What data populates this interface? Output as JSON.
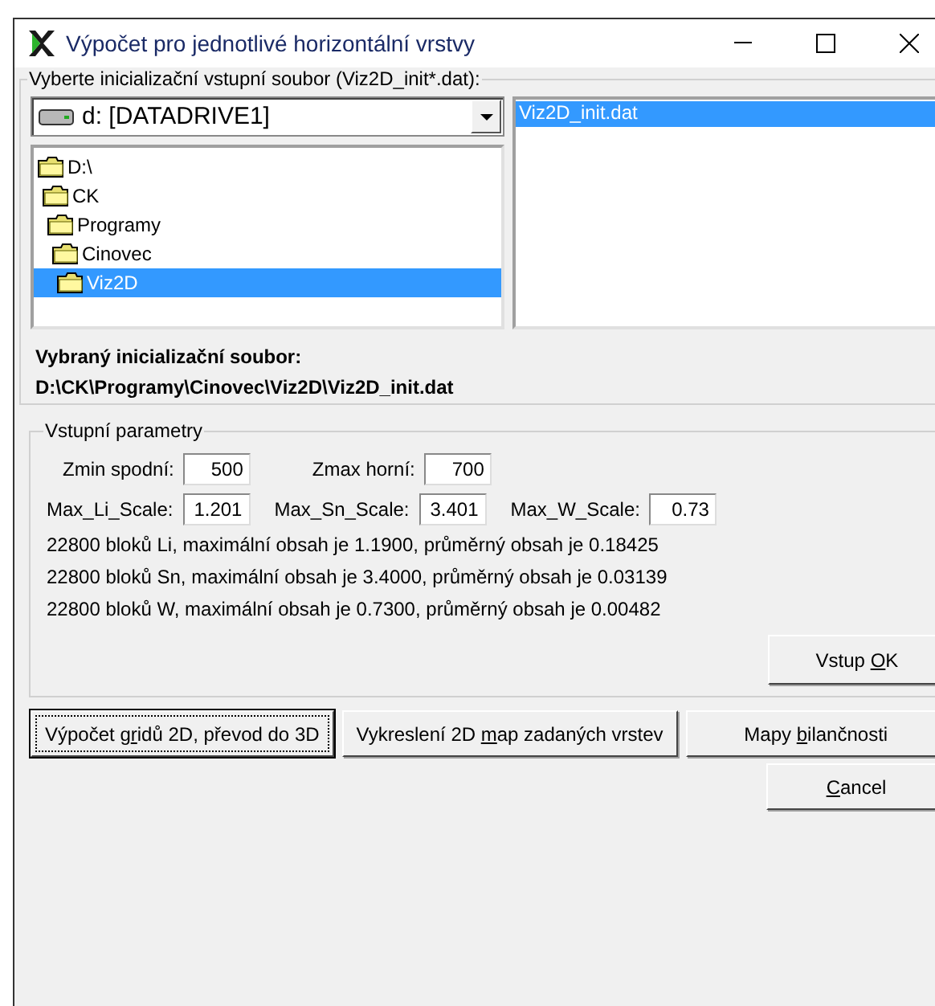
{
  "window": {
    "title": "Výpočet pro jednotlivé horizontální vrstvy"
  },
  "file_group": {
    "legend": "Vyberte inicializační vstupní soubor (Viz2D_init*.dat):",
    "drive": {
      "value": "d: [DATADRIVE1]"
    },
    "folders": [
      {
        "name": "D:\\",
        "selected": false,
        "children": [
          {
            "name": "CK",
            "selected": false,
            "children": [
              {
                "name": "Programy",
                "selected": false,
                "children": [
                  {
                    "name": "Cinovec",
                    "selected": false,
                    "children": [
                      {
                        "name": "Viz2D",
                        "selected": true
                      }
                    ]
                  }
                ]
              }
            ]
          }
        ]
      }
    ],
    "files": [
      {
        "name": "Viz2D_init.dat",
        "selected": true
      }
    ],
    "selected_label": "Vybraný inicializační soubor:",
    "selected_path": "D:\\CK\\Programy\\Cinovec\\Viz2D\\Viz2D_init.dat"
  },
  "params": {
    "legend": "Vstupní parametry",
    "rows": [
      [
        {
          "label": "Zmin spodní:",
          "value": "500"
        },
        {
          "label": "Zmax horní:",
          "value": "700"
        }
      ],
      [
        {
          "label": "Max_Li_Scale:",
          "value": "1.201"
        },
        {
          "label": "Max_Sn_Scale:",
          "value": "3.401"
        },
        {
          "label": "Max_W_Scale:",
          "value": "0.73"
        }
      ]
    ],
    "info": [
      "22800 bloků Li, maximální obsah je 1.1900, průměrný obsah je 0.18425",
      "22800 bloků Sn, maximální obsah je 3.4000, průměrný obsah je 0.03139",
      "22800 bloků W, maximální obsah je 0.7300, průměrný obsah je 0.00482"
    ],
    "ok_button": {
      "label": {
        "before": "Vstup ",
        "accel": "O",
        "after": "K"
      }
    }
  },
  "buttons": [
    {
      "label": {
        "before": "Výpočet g",
        "accel": "r",
        "after": "idů 2D, převod do 3D"
      },
      "focused": true
    },
    {
      "label": {
        "before": "Vykreslení 2D ",
        "accel": "m",
        "after": "ap zadaných vrstev"
      },
      "focused": false
    },
    {
      "label": {
        "before": "Mapy ",
        "accel": "b",
        "after": "ilančnosti"
      },
      "focused": false
    }
  ],
  "cancel": {
    "label": {
      "accel": "C",
      "after": "ancel"
    }
  }
}
